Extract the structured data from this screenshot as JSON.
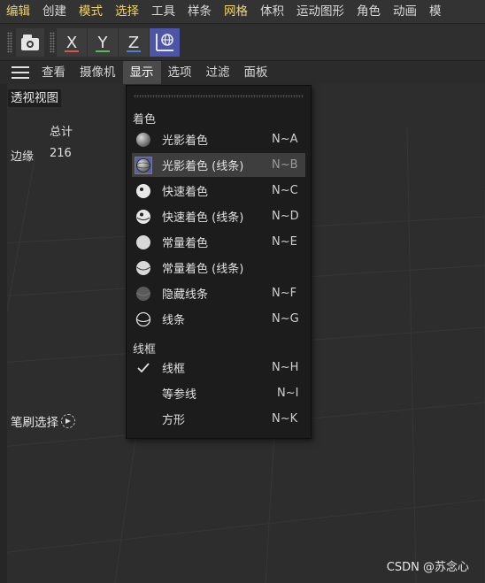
{
  "menubar": {
    "items": [
      {
        "label": "编辑",
        "highlight": true
      },
      {
        "label": "创建",
        "highlight": false
      },
      {
        "label": "模式",
        "highlight": true
      },
      {
        "label": "选择",
        "highlight": true
      },
      {
        "label": "工具",
        "highlight": false
      },
      {
        "label": "样条",
        "highlight": false
      },
      {
        "label": "网格",
        "highlight": true
      },
      {
        "label": "体积",
        "highlight": false
      },
      {
        "label": "运动图形",
        "highlight": false
      },
      {
        "label": "角色",
        "highlight": false
      },
      {
        "label": "动画",
        "highlight": false
      },
      {
        "label": "模",
        "highlight": false
      }
    ]
  },
  "toolbar": {
    "axis_x": "X",
    "axis_y": "Y",
    "axis_z": "Z",
    "colors": {
      "x": "#d9534f",
      "y": "#5cb85c",
      "z": "#4a7fd6",
      "world": "#4c55a8"
    }
  },
  "viewbar": {
    "items": [
      "查看",
      "摄像机",
      "显示",
      "选项",
      "过滤",
      "面板"
    ],
    "active": "显示"
  },
  "viewport": {
    "label": "透视视图",
    "stats_header": "总计",
    "stats_label": "边缘",
    "stats_value": "216",
    "brush_label": "笔刷选择",
    "watermark": "CSDN @苏念心"
  },
  "dropdown": {
    "section_shading": "着色",
    "section_wire": "线框",
    "shading_items": [
      {
        "label": "光影着色",
        "shortcut": "N~A",
        "icon": "shaded-sphere-icon"
      },
      {
        "label": "光影着色 (线条)",
        "shortcut": "N~B",
        "icon": "shaded-wire-sphere-icon",
        "selected": true
      },
      {
        "label": "快速着色",
        "shortcut": "N~C",
        "icon": "quick-shade-icon"
      },
      {
        "label": "快速着色 (线条)",
        "shortcut": "N~D",
        "icon": "quick-shade-wire-icon"
      },
      {
        "label": "常量着色",
        "shortcut": "N~E",
        "icon": "constant-shade-icon"
      },
      {
        "label": "常量着色 (线条)",
        "shortcut": "",
        "icon": "constant-shade-wire-icon"
      },
      {
        "label": "隐藏线条",
        "shortcut": "N~F",
        "icon": "hidden-line-icon"
      },
      {
        "label": "线条",
        "shortcut": "N~G",
        "icon": "lines-icon"
      }
    ],
    "wire_items": [
      {
        "label": "线框",
        "shortcut": "N~H",
        "checked": true
      },
      {
        "label": "等参线",
        "shortcut": "N~I",
        "checked": false
      },
      {
        "label": "方形",
        "shortcut": "N~K",
        "checked": false
      }
    ]
  }
}
